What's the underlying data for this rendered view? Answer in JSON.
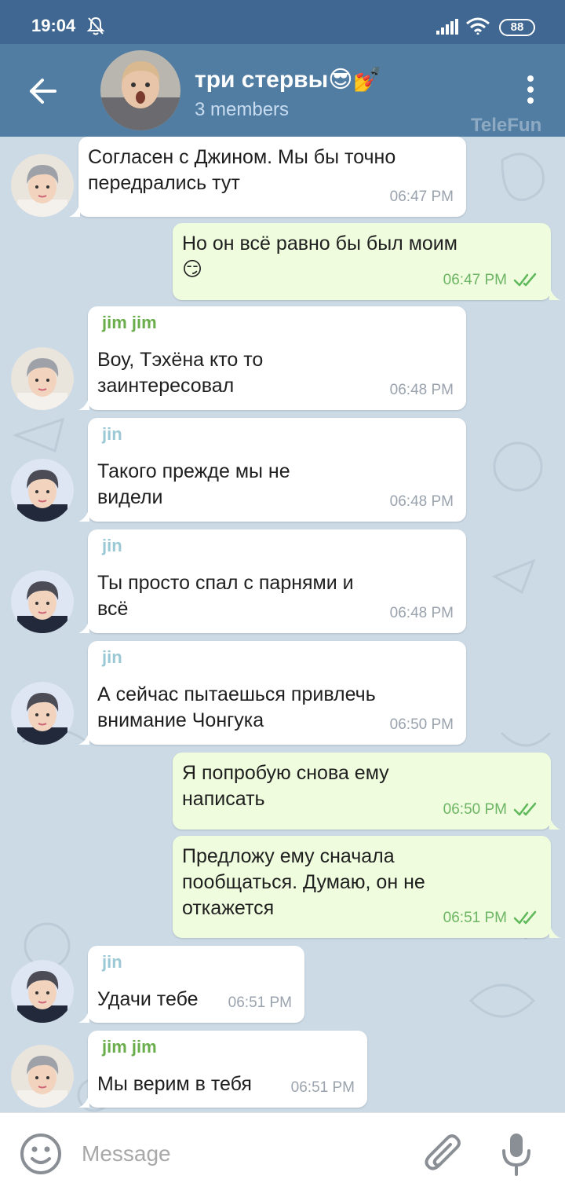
{
  "status": {
    "time": "19:04",
    "battery": "88",
    "icons": [
      "bell-muted-icon",
      "signal-icon",
      "wifi-icon",
      "battery-icon"
    ]
  },
  "header": {
    "title": "три стервы😎💅",
    "subtitle": "3 members",
    "watermark": "TeleFun"
  },
  "messages": [
    {
      "dir": "in",
      "sender": "",
      "avatar": "jimjim",
      "lines": [
        "Согласен с Джином. Мы бы точно",
        "передрались тут"
      ],
      "time": "06:47 PM"
    },
    {
      "dir": "out",
      "lines": [
        "Но он всё равно бы был моим",
        "😏"
      ],
      "time": "06:47 PM"
    },
    {
      "dir": "in",
      "sender": "jim jim",
      "avatar": "jimjim",
      "lines": [
        "Воу, Тэхёна кто то",
        "заинтересовал"
      ],
      "time": "06:48 PM"
    },
    {
      "dir": "in",
      "sender": "jin",
      "avatar": "jin",
      "lines": [
        "Такого прежде мы не",
        "видели"
      ],
      "time": "06:48 PM"
    },
    {
      "dir": "in",
      "sender": "jin",
      "avatar": "jin",
      "lines": [
        "Ты просто спал с парнями и",
        "всё"
      ],
      "time": "06:48 PM"
    },
    {
      "dir": "in",
      "sender": "jin",
      "avatar": "jin",
      "lines": [
        "А сейчас пытаешься привлечь",
        "внимание Чонгука"
      ],
      "time": "06:50 PM"
    },
    {
      "dir": "out",
      "lines": [
        "Я попробую снова ему",
        "написать"
      ],
      "time": "06:50 PM"
    },
    {
      "dir": "out",
      "lines": [
        "Предложу ему сначала",
        "пообщаться. Думаю, он не",
        "откажется"
      ],
      "time": "06:51 PM"
    },
    {
      "dir": "in",
      "sender": "jin",
      "avatar": "jin",
      "lines": [
        "Удачи тебе"
      ],
      "time": "06:51 PM"
    },
    {
      "dir": "in",
      "sender": "jim jim",
      "avatar": "jimjim",
      "lines": [
        "Мы верим в тебя"
      ],
      "time": "06:51 PM"
    }
  ],
  "input": {
    "placeholder": "Message"
  },
  "colors": {
    "header": "#527da3",
    "status_bar": "#3f6791",
    "chat_bg": "#ccdae6",
    "out_bubble": "#effdde",
    "in_bubble": "#ffffff",
    "sender_jimjim": "#6aae4c",
    "sender_jin": "#9ac8d4"
  }
}
